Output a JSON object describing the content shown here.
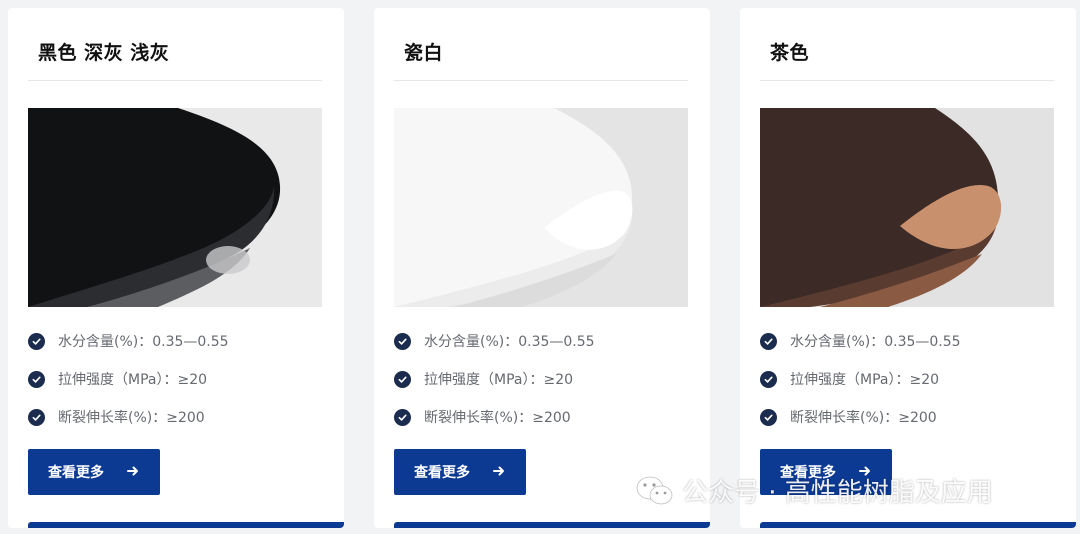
{
  "products": [
    {
      "name": "黑色 深灰 浅灰",
      "swatch_colors": {
        "bg": "#e9e9e9",
        "dark": "#111214",
        "mid": "#2b2d31",
        "light": "#c9c9cc"
      },
      "specs": [
        "水分含量(%)：0.35—0.55",
        "拉伸强度（MPa）：≥20",
        "断裂伸长率(%)：≥200"
      ],
      "button_label": "查看更多"
    },
    {
      "name": "瓷白",
      "swatch_colors": {
        "bg": "#e4e4e4",
        "dark": "#f7f7f7",
        "mid": "#e2e2e2",
        "light": "#ffffff"
      },
      "specs": [
        "水分含量(%)：0.35—0.55",
        "拉伸强度（MPa）：≥20",
        "断裂伸长率(%)：≥200"
      ],
      "button_label": "查看更多"
    },
    {
      "name": "茶色",
      "swatch_colors": {
        "bg": "#e2e2e2",
        "dark": "#3b2a25",
        "mid": "#5a3b30",
        "light": "#c8906d"
      },
      "specs": [
        "水分含量(%)：0.35—0.55",
        "拉伸强度（MPa）：≥20",
        "断裂伸长率(%)：≥200"
      ],
      "button_label": "查看更多"
    }
  ],
  "watermark": {
    "text": "公众号 · 高性能树脂及应用",
    "icon": "wechat-icon"
  },
  "colors": {
    "accent": "#0c3a93",
    "check": "#1b2c4e",
    "text": "#666a70"
  }
}
